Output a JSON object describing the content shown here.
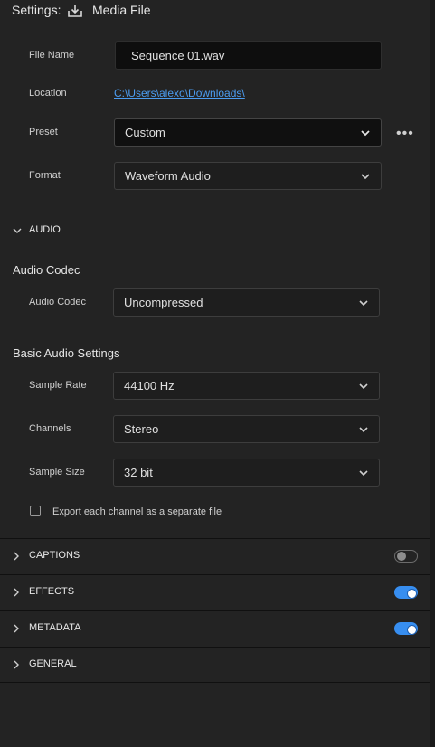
{
  "header": {
    "title": "Settings:",
    "media_label": "Media File"
  },
  "fields": {
    "file_name_label": "File Name",
    "file_name_value": "Sequence 01.wav",
    "location_label": "Location",
    "location_value": "C:\\Users\\alexo\\Downloads\\",
    "preset_label": "Preset",
    "preset_value": "Custom",
    "format_label": "Format",
    "format_value": "Waveform Audio",
    "more_glyph": "•••"
  },
  "audio": {
    "section_label": "AUDIO",
    "codec_heading": "Audio Codec",
    "codec_label": "Audio Codec",
    "codec_value": "Uncompressed",
    "basic_heading": "Basic Audio Settings",
    "sample_rate_label": "Sample Rate",
    "sample_rate_value": "44100 Hz",
    "channels_label": "Channels",
    "channels_value": "Stereo",
    "sample_size_label": "Sample Size",
    "sample_size_value": "32 bit",
    "separate_file_label": "Export each channel as a separate file",
    "separate_file_checked": false
  },
  "sections": [
    {
      "label": "CAPTIONS",
      "toggle": "off"
    },
    {
      "label": "EFFECTS",
      "toggle": "on"
    },
    {
      "label": "METADATA",
      "toggle": "on"
    },
    {
      "label": "GENERAL"
    }
  ],
  "colors": {
    "background": "#232323",
    "link": "#4b9cf0",
    "toggle_on": "#378ef0"
  }
}
